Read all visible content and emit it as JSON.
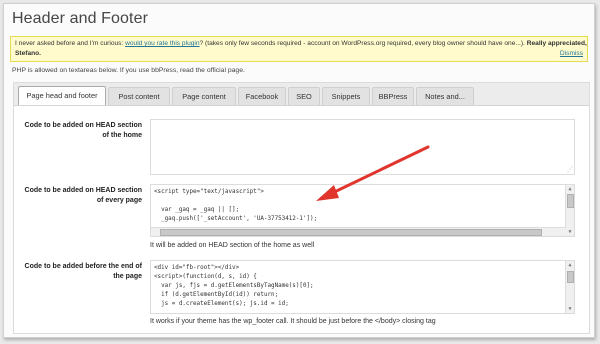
{
  "page": {
    "title": "Header and Footer"
  },
  "notice": {
    "text_prefix": "I never asked before and I'm curious: ",
    "link": "would you rate this plugin",
    "text_suffix": "? (takes only few seconds required - account on WordPress.org required, every blog owner should have one...). ",
    "thanks": "Really appreciated,",
    "signature": "Stefano.",
    "dismiss": "Dismiss"
  },
  "intro": "PHP is allowed on textareas below. If you use bbPress, read the official page.",
  "tabs": [
    {
      "label": "Page head and footer",
      "active": true
    },
    {
      "label": "Post content"
    },
    {
      "label": "Page content"
    },
    {
      "label": "Facebook"
    },
    {
      "label": "SEO"
    },
    {
      "label": "Snippets"
    },
    {
      "label": "BBPress"
    },
    {
      "label": "Notes and..."
    }
  ],
  "rows": {
    "home_head": {
      "label": "Code to be added on HEAD section of the home",
      "code": ""
    },
    "every_head": {
      "label": "Code to be added on HEAD section of every page",
      "code": "<script type=\"text/javascript\">\n\n  var _gaq = _gaq || [];\n  _gaq.push(['_setAccount', 'UA-37753412-1']);",
      "hint": "It will be added on HEAD section of the home as well"
    },
    "body_end": {
      "label": "Code to be added before the end of the page",
      "code": "<div id=\"fb-root\"></div>\n<script>(function(d, s, id) {\n  var js, fjs = d.getElementsByTagName(s)[0];\n  if (d.getElementById(id)) return;\n  js = d.createElement(s); js.id = id;",
      "hint": "It works if your theme has the wp_footer call. It should be just before the </body> closing tag"
    }
  },
  "colors": {
    "arrow": "#e1342c",
    "notice_bg": "#fffbcc",
    "link": "#21759b"
  },
  "icons": {
    "scroll_up": "▲",
    "scroll_down": "▼",
    "resize": "⋰"
  }
}
